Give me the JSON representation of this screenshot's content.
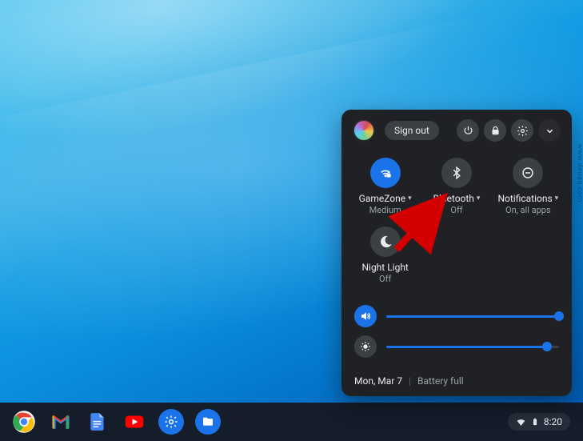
{
  "panel": {
    "sign_out_label": "Sign out",
    "tiles": {
      "wifi": {
        "label": "GameZone",
        "sub": "Medium"
      },
      "bt": {
        "label": "Bluetooth",
        "sub": "Off"
      },
      "notif": {
        "label": "Notifications",
        "sub": "On, all apps"
      },
      "night": {
        "label": "Night Light",
        "sub": "Off"
      }
    },
    "sliders": {
      "volume_pct": 100,
      "brightness_pct": 93
    },
    "footer": {
      "date": "Mon, Mar 7",
      "battery": "Battery full"
    }
  },
  "shelf": {
    "clock": "8:20"
  },
  "watermark": "www.deuaq.com"
}
